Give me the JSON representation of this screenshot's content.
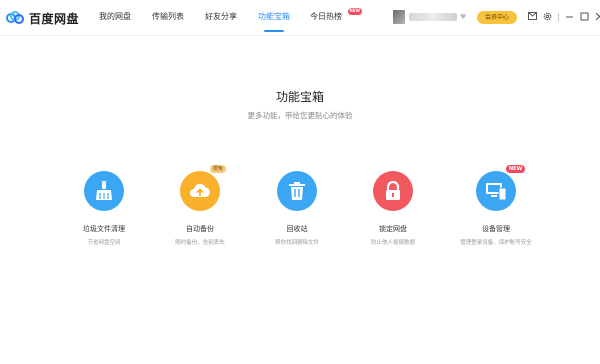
{
  "app": {
    "name": "百度网盘"
  },
  "tabs": [
    {
      "label": "我的网盘"
    },
    {
      "label": "传输列表"
    },
    {
      "label": "好友分享"
    },
    {
      "label": "功能宝箱"
    },
    {
      "label": "今日热榜",
      "badge": "NEW"
    }
  ],
  "header": {
    "vip_label": "会员中心"
  },
  "icons": {
    "logo": "baidu-cloud-logo",
    "heart": "heart-icon",
    "mail": "mail-icon",
    "settings": "gear-icon",
    "minimize": "minimize-icon",
    "maximize": "maximize-icon",
    "close": "close-icon"
  },
  "page": {
    "title": "功能宝箱",
    "subtitle": "更多功能，带给您更贴心的体验"
  },
  "tools": [
    {
      "name": "垃圾文件清理",
      "desc": "节省网盘空间",
      "color": "#3aa6f4"
    },
    {
      "name": "自动备份",
      "desc": "随时备份，告别丢失",
      "color": "#f9b02b",
      "tag": "限免"
    },
    {
      "name": "回收站",
      "desc": "帮你找回删除文件",
      "color": "#3aa6f4"
    },
    {
      "name": "锁定网盘",
      "desc": "防止他人偷窥数据",
      "color": "#f2585f"
    },
    {
      "name": "设备管理",
      "desc": "管理登录设备，保护账号安全",
      "color": "#3aa6f4",
      "tag": "NEW"
    }
  ]
}
